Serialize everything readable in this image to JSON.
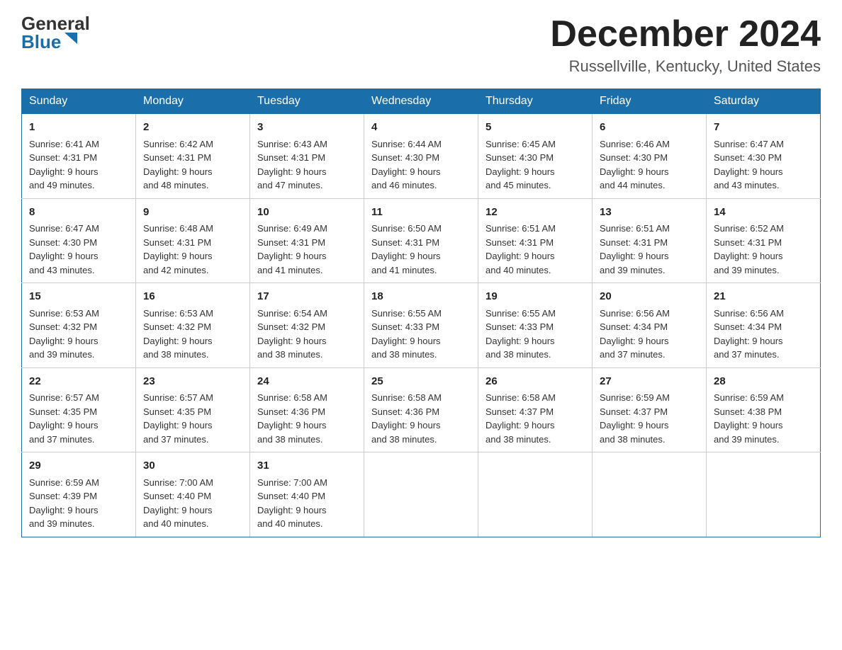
{
  "header": {
    "logo_line1": "General",
    "logo_line2": "Blue",
    "month_title": "December 2024",
    "location": "Russellville, Kentucky, United States"
  },
  "days_of_week": [
    "Sunday",
    "Monday",
    "Tuesday",
    "Wednesday",
    "Thursday",
    "Friday",
    "Saturday"
  ],
  "weeks": [
    [
      {
        "day": "1",
        "sunrise": "6:41 AM",
        "sunset": "4:31 PM",
        "daylight": "9 hours and 49 minutes."
      },
      {
        "day": "2",
        "sunrise": "6:42 AM",
        "sunset": "4:31 PM",
        "daylight": "9 hours and 48 minutes."
      },
      {
        "day": "3",
        "sunrise": "6:43 AM",
        "sunset": "4:31 PM",
        "daylight": "9 hours and 47 minutes."
      },
      {
        "day": "4",
        "sunrise": "6:44 AM",
        "sunset": "4:30 PM",
        "daylight": "9 hours and 46 minutes."
      },
      {
        "day": "5",
        "sunrise": "6:45 AM",
        "sunset": "4:30 PM",
        "daylight": "9 hours and 45 minutes."
      },
      {
        "day": "6",
        "sunrise": "6:46 AM",
        "sunset": "4:30 PM",
        "daylight": "9 hours and 44 minutes."
      },
      {
        "day": "7",
        "sunrise": "6:47 AM",
        "sunset": "4:30 PM",
        "daylight": "9 hours and 43 minutes."
      }
    ],
    [
      {
        "day": "8",
        "sunrise": "6:47 AM",
        "sunset": "4:30 PM",
        "daylight": "9 hours and 43 minutes."
      },
      {
        "day": "9",
        "sunrise": "6:48 AM",
        "sunset": "4:31 PM",
        "daylight": "9 hours and 42 minutes."
      },
      {
        "day": "10",
        "sunrise": "6:49 AM",
        "sunset": "4:31 PM",
        "daylight": "9 hours and 41 minutes."
      },
      {
        "day": "11",
        "sunrise": "6:50 AM",
        "sunset": "4:31 PM",
        "daylight": "9 hours and 41 minutes."
      },
      {
        "day": "12",
        "sunrise": "6:51 AM",
        "sunset": "4:31 PM",
        "daylight": "9 hours and 40 minutes."
      },
      {
        "day": "13",
        "sunrise": "6:51 AM",
        "sunset": "4:31 PM",
        "daylight": "9 hours and 39 minutes."
      },
      {
        "day": "14",
        "sunrise": "6:52 AM",
        "sunset": "4:31 PM",
        "daylight": "9 hours and 39 minutes."
      }
    ],
    [
      {
        "day": "15",
        "sunrise": "6:53 AM",
        "sunset": "4:32 PM",
        "daylight": "9 hours and 39 minutes."
      },
      {
        "day": "16",
        "sunrise": "6:53 AM",
        "sunset": "4:32 PM",
        "daylight": "9 hours and 38 minutes."
      },
      {
        "day": "17",
        "sunrise": "6:54 AM",
        "sunset": "4:32 PM",
        "daylight": "9 hours and 38 minutes."
      },
      {
        "day": "18",
        "sunrise": "6:55 AM",
        "sunset": "4:33 PM",
        "daylight": "9 hours and 38 minutes."
      },
      {
        "day": "19",
        "sunrise": "6:55 AM",
        "sunset": "4:33 PM",
        "daylight": "9 hours and 38 minutes."
      },
      {
        "day": "20",
        "sunrise": "6:56 AM",
        "sunset": "4:34 PM",
        "daylight": "9 hours and 37 minutes."
      },
      {
        "day": "21",
        "sunrise": "6:56 AM",
        "sunset": "4:34 PM",
        "daylight": "9 hours and 37 minutes."
      }
    ],
    [
      {
        "day": "22",
        "sunrise": "6:57 AM",
        "sunset": "4:35 PM",
        "daylight": "9 hours and 37 minutes."
      },
      {
        "day": "23",
        "sunrise": "6:57 AM",
        "sunset": "4:35 PM",
        "daylight": "9 hours and 37 minutes."
      },
      {
        "day": "24",
        "sunrise": "6:58 AM",
        "sunset": "4:36 PM",
        "daylight": "9 hours and 38 minutes."
      },
      {
        "day": "25",
        "sunrise": "6:58 AM",
        "sunset": "4:36 PM",
        "daylight": "9 hours and 38 minutes."
      },
      {
        "day": "26",
        "sunrise": "6:58 AM",
        "sunset": "4:37 PM",
        "daylight": "9 hours and 38 minutes."
      },
      {
        "day": "27",
        "sunrise": "6:59 AM",
        "sunset": "4:37 PM",
        "daylight": "9 hours and 38 minutes."
      },
      {
        "day": "28",
        "sunrise": "6:59 AM",
        "sunset": "4:38 PM",
        "daylight": "9 hours and 39 minutes."
      }
    ],
    [
      {
        "day": "29",
        "sunrise": "6:59 AM",
        "sunset": "4:39 PM",
        "daylight": "9 hours and 39 minutes."
      },
      {
        "day": "30",
        "sunrise": "7:00 AM",
        "sunset": "4:40 PM",
        "daylight": "9 hours and 40 minutes."
      },
      {
        "day": "31",
        "sunrise": "7:00 AM",
        "sunset": "4:40 PM",
        "daylight": "9 hours and 40 minutes."
      },
      null,
      null,
      null,
      null
    ]
  ],
  "labels": {
    "sunrise": "Sunrise:",
    "sunset": "Sunset:",
    "daylight": "Daylight: 9 hours"
  },
  "colors": {
    "header_bg": "#1a6faa",
    "header_text": "#ffffff",
    "border": "#aaaaaa",
    "row_border": "#cccccc"
  }
}
